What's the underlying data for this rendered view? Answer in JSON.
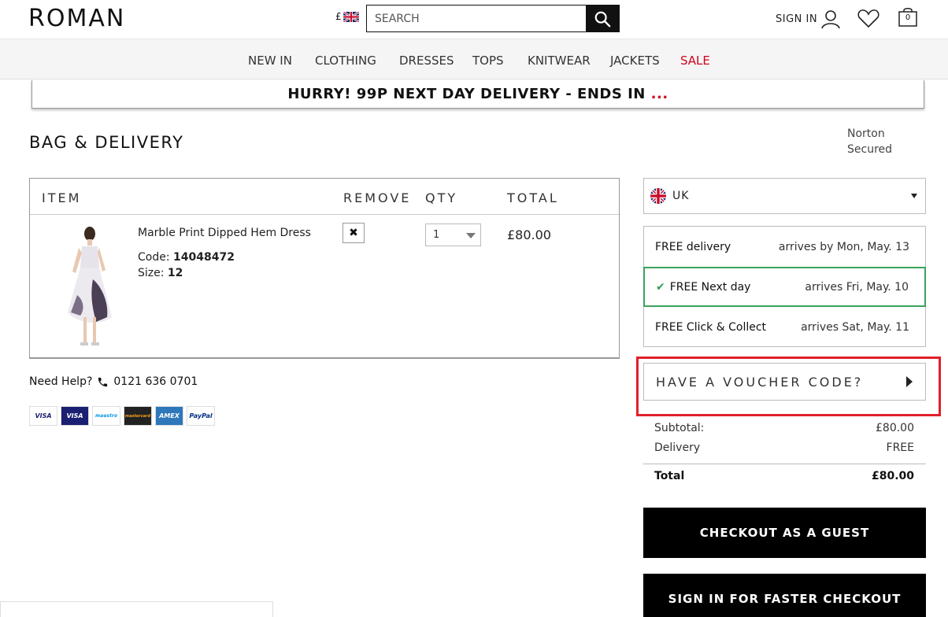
{
  "header": {
    "logo": "ROMAN",
    "currency_symbol": "£",
    "search_placeholder": "SEARCH",
    "signin_label": "SIGN IN",
    "bag_count": "0"
  },
  "nav": {
    "items": [
      "NEW IN",
      "CLOTHING",
      "DRESSES",
      "TOPS",
      "KNITWEAR",
      "JACKETS"
    ],
    "sale": "SALE",
    "sale_color": "#d0021b"
  },
  "promo": {
    "text": "HURRY! 99P NEXT DAY DELIVERY - ENDS IN",
    "suffix": "..."
  },
  "page": {
    "title": "BAG & DELIVERY",
    "norton_alt": "Norton Secured"
  },
  "bag": {
    "headers": {
      "item": "ITEM",
      "remove": "REMOVE",
      "qty": "QTY",
      "total": "TOTAL"
    },
    "product": {
      "name": "Marble Print Dipped Hem Dress",
      "code_label": "Code:",
      "code": "14048472",
      "size_label": "Size:",
      "size": "12",
      "qty": "1",
      "total": "£80.00"
    }
  },
  "help": {
    "label": "Need Help?",
    "phone": "0121 636 0701",
    "cards": [
      "VISA",
      "VISA",
      "maestro",
      "mastercard",
      "AMEX",
      "PayPal"
    ]
  },
  "delivery": {
    "country": "UK",
    "options": [
      {
        "name": "FREE delivery",
        "arrives": "arrives by Mon, May. 13",
        "selected": false
      },
      {
        "name": "FREE Next day",
        "arrives": "arrives Fri, May. 10",
        "selected": true
      },
      {
        "name": "FREE Click & Collect",
        "arrives": "arrives Sat, May. 11",
        "selected": false
      }
    ],
    "selected_color": "#3aa35c"
  },
  "voucher": {
    "label": "HAVE A VOUCHER CODE?",
    "highlight_color": "#e0202b"
  },
  "summary": {
    "subtotal_label": "Subtotal:",
    "subtotal": "£80.00",
    "delivery_label": "Delivery",
    "delivery": "FREE",
    "total_label": "Total",
    "total": "£80.00"
  },
  "actions": {
    "guest_checkout": "CHECKOUT AS A GUEST",
    "signin_checkout": "SIGN IN FOR FASTER CHECKOUT"
  }
}
